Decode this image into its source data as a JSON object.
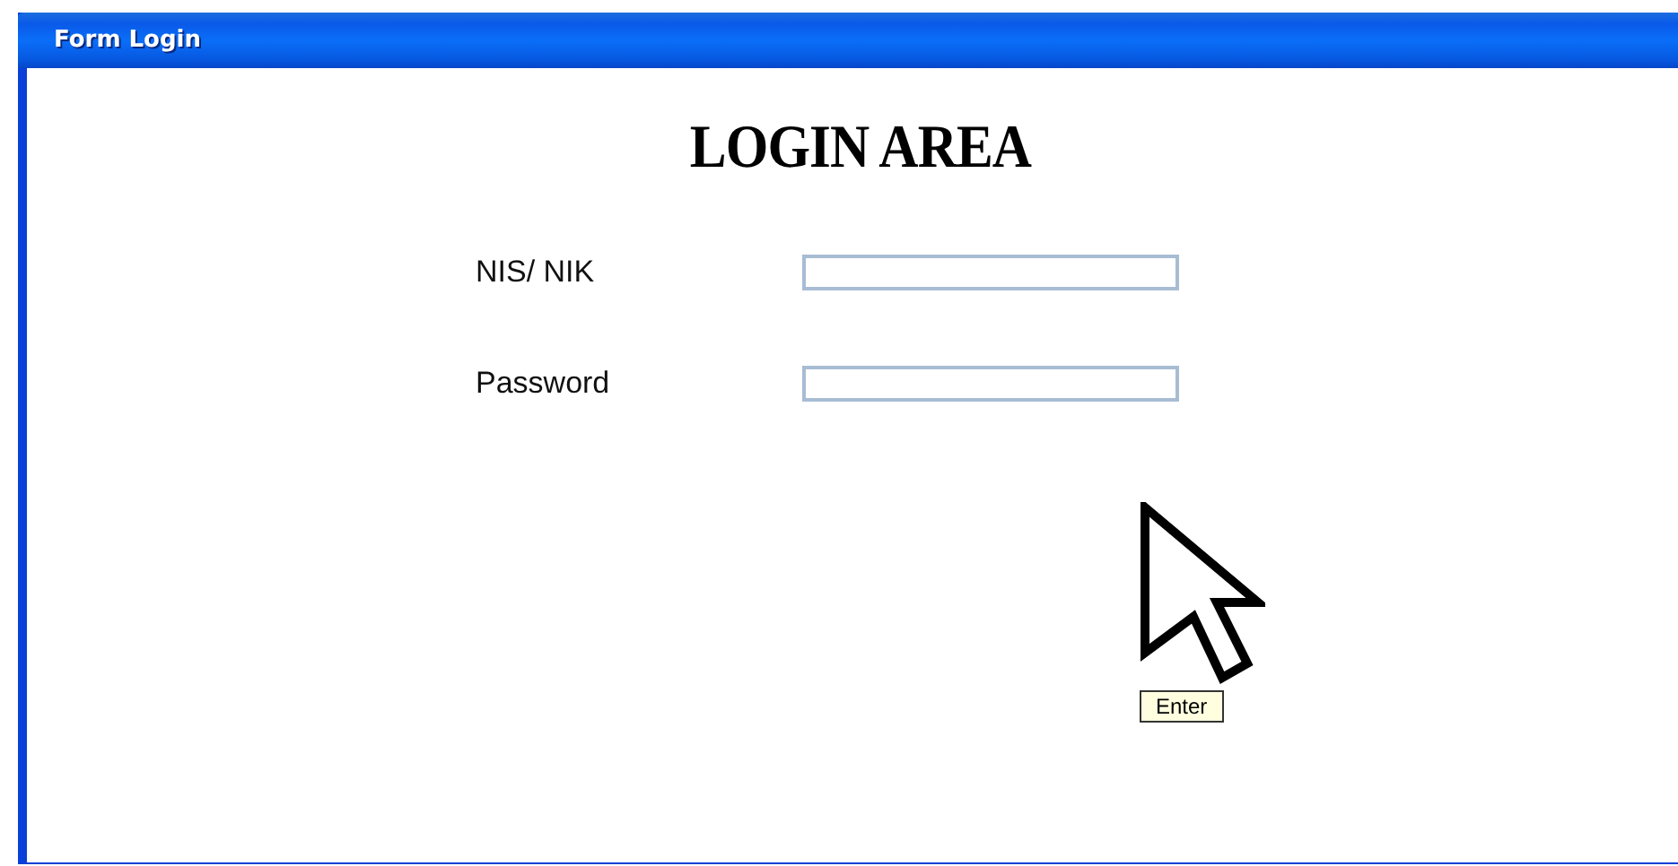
{
  "window": {
    "title": "Form Login"
  },
  "heading": "LOGIN AREA",
  "fields": [
    {
      "label": "NIS/ NIK"
    },
    {
      "label": "Password"
    }
  ],
  "tooltip": "Enter"
}
